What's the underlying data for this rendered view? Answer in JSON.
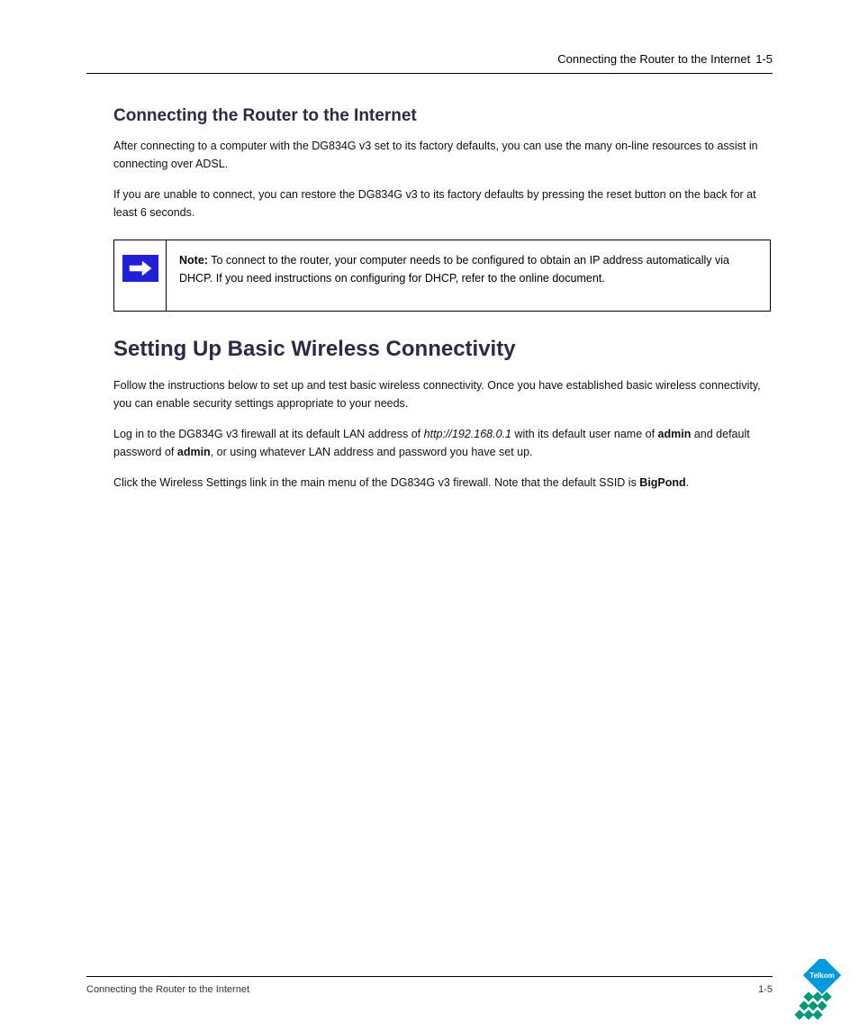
{
  "header": {
    "title": "Connecting the Router to the Internet",
    "page": "1-5"
  },
  "section_connection": {
    "heading": "Connecting the Router to the Internet",
    "p1": "After connecting to a computer with the DG834G v3 set to its factory defaults, you can use the many on-line resources to assist in connecting over ADSL.",
    "p2": "If you are unable to connect, you can restore the DG834G v3 to its factory defaults by pressing the reset button on the back for at least 6 seconds."
  },
  "note": {
    "label": "Note:",
    "text": " To connect to the router, your computer needs to be configured to obtain an IP address automatically via DHCP. If you need instructions on configuring for DHCP, refer to the online document."
  },
  "section_wireless": {
    "heading": "Setting Up Basic Wireless Connectivity",
    "p1": "Follow the instructions below to set up and test basic wireless connectivity. Once you have established basic wireless connectivity, you can enable security settings appropriate to your needs.",
    "p2_a": "Log in to the DG834G v3 firewall at its default LAN address of ",
    "p2_url": "http://192.168.0.1",
    "p2_b": " with its default user name of ",
    "p2_user": "admin ",
    "p2_c": "and default password of ",
    "p2_pass": "admin",
    "p2_d": ", or using whatever LAN address and password you have set up.",
    "p3_a": "Click the Wireless Settings link in the main menu of the DG834G v3 firewall. Note that the default SSID is ",
    "p3_ssid": "BigPond",
    "p3_b": "."
  },
  "footer": {
    "left": "Connecting the Router to the Internet",
    "right": "1-5"
  }
}
